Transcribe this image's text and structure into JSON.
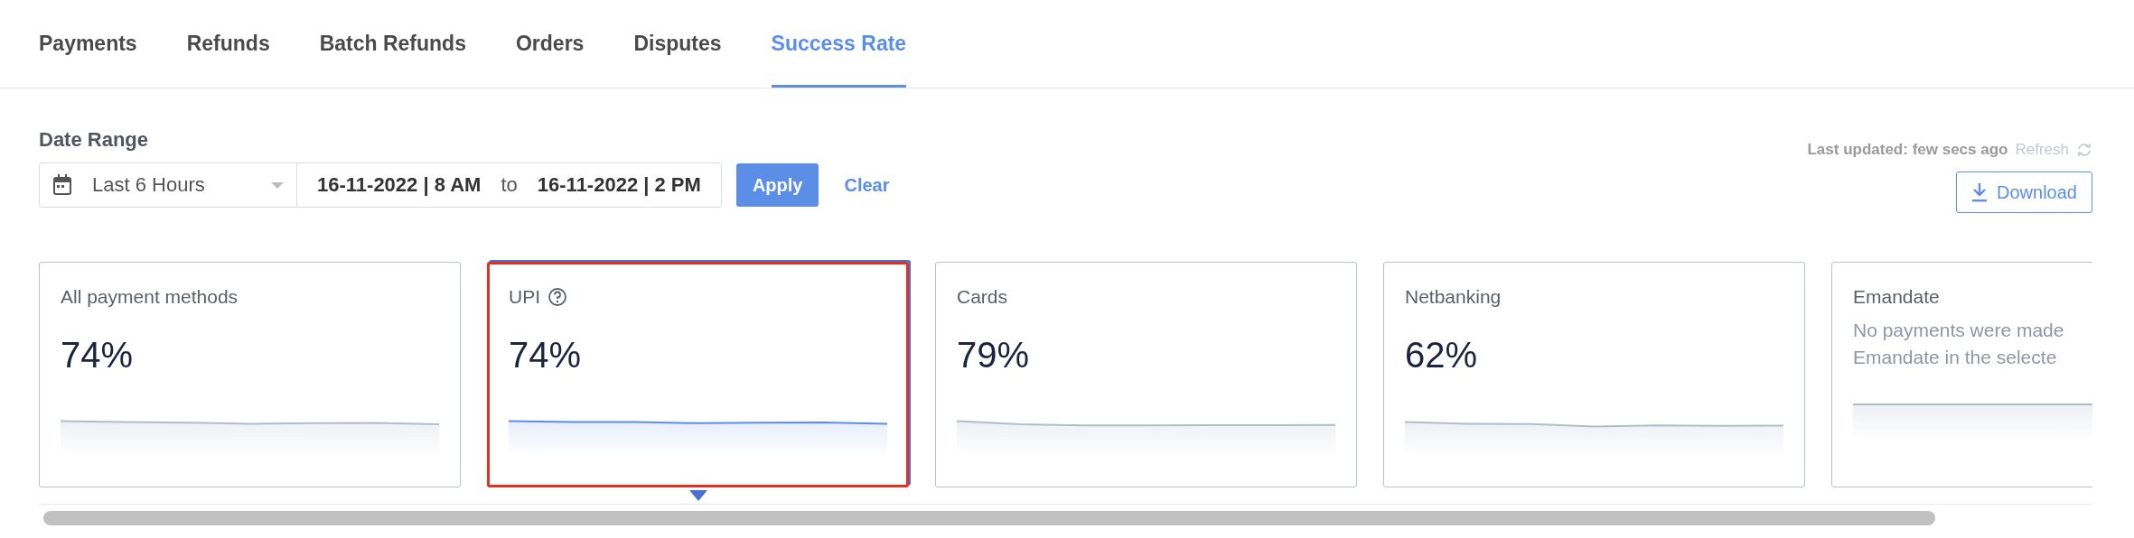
{
  "tabs": [
    {
      "label": "Payments",
      "selected": false
    },
    {
      "label": "Refunds",
      "selected": false
    },
    {
      "label": "Batch Refunds",
      "selected": false
    },
    {
      "label": "Orders",
      "selected": false
    },
    {
      "label": "Disputes",
      "selected": false
    },
    {
      "label": "Success Rate",
      "selected": true
    }
  ],
  "date_range": {
    "label": "Date Range",
    "preset": "Last 6 Hours",
    "from": "16-11-2022 | 8 AM",
    "separator": "to",
    "to": "16-11-2022 | 2 PM"
  },
  "apply_button": "Apply",
  "clear_link": "Clear",
  "last_updated": "Last updated: few secs ago",
  "refresh": "Refresh",
  "download_button": "Download",
  "cards": [
    {
      "kind": "rate",
      "title": "All payment methods",
      "has_help": false,
      "value": "74%",
      "selected": false
    },
    {
      "kind": "rate",
      "title": "UPI",
      "has_help": true,
      "value": "74%",
      "selected": true
    },
    {
      "kind": "rate",
      "title": "Cards",
      "has_help": false,
      "value": "79%",
      "selected": false
    },
    {
      "kind": "rate",
      "title": "Netbanking",
      "has_help": false,
      "value": "62%",
      "selected": false
    },
    {
      "kind": "empty",
      "title": "Emandate",
      "has_help": false,
      "message_lines": [
        "No payments were made",
        "Emandate in the selecte"
      ],
      "selected": false
    }
  ]
}
